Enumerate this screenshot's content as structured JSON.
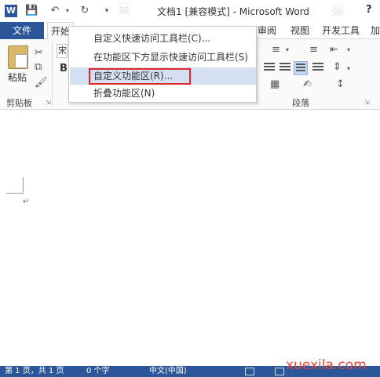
{
  "window": {
    "title": "文档1 [兼容模式] - Microsoft Word",
    "help": "?",
    "app_badge": "W"
  },
  "qat": {
    "save_icon": "save-icon",
    "undo_icon": "undo-icon",
    "redo_icon": "redo-icon"
  },
  "tabs": {
    "file": "文件",
    "home": "开始",
    "review": "审阅",
    "view": "视图",
    "developer": "开发工具",
    "addins": "加"
  },
  "ribbon": {
    "paste_label": "粘贴",
    "clipboard_group": "剪贴板",
    "paragraph_group": "段落",
    "font_name": "宋",
    "bold": "B"
  },
  "context_menu": {
    "items": [
      {
        "label": "自定义快速访问工具栏(C)..."
      },
      {
        "label": "在功能区下方显示快速访问工具栏(S)"
      },
      {
        "label": "自定义功能区(R)..."
      },
      {
        "label": "折叠功能区(N)"
      }
    ],
    "highlighted_index": 2
  },
  "document": {
    "paragraph_mark": "↵"
  },
  "statusbar": {
    "page": "第 1 页，共 1 页",
    "words": "0 个字",
    "language": "中文(中国)"
  },
  "watermark": "xuexila.com",
  "colors": {
    "accent": "#2b579a",
    "menu_hover": "#d5e1f2",
    "highlight_box": "#e0262b"
  }
}
